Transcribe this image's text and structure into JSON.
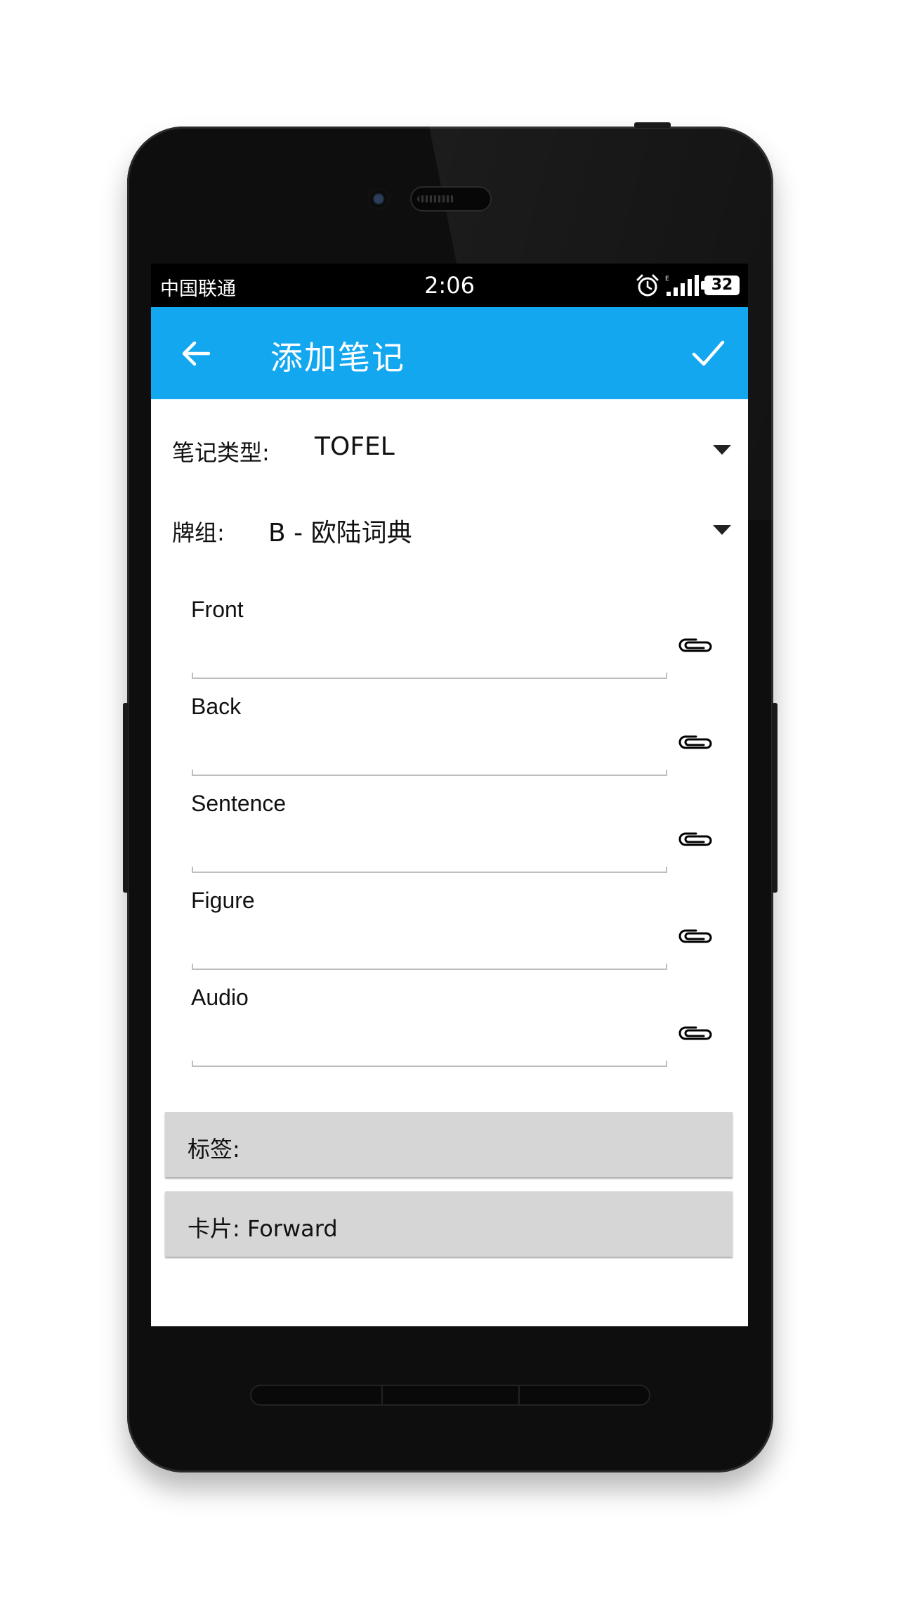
{
  "status_bar": {
    "carrier": "中国联通",
    "time": "2:06",
    "network_type": "E",
    "battery": "32"
  },
  "app_bar": {
    "title": "添加笔记",
    "back_icon": "arrow-left",
    "confirm_icon": "checkmark"
  },
  "form": {
    "note_type": {
      "label": "笔记类型:",
      "value": "TOFEL"
    },
    "deck": {
      "label": "牌组:",
      "value": "B - 欧陆词典"
    },
    "fields": [
      {
        "label": "Front",
        "value": ""
      },
      {
        "label": "Back",
        "value": ""
      },
      {
        "label": "Sentence",
        "value": ""
      },
      {
        "label": "Figure",
        "value": ""
      },
      {
        "label": "Audio",
        "value": ""
      }
    ],
    "tags_button": "标签:",
    "cards_button": "卡片: Forward"
  },
  "colors": {
    "app_bar": "#13a7ef",
    "button_bg": "#d6d6d6",
    "device": "#0e0e0e"
  }
}
